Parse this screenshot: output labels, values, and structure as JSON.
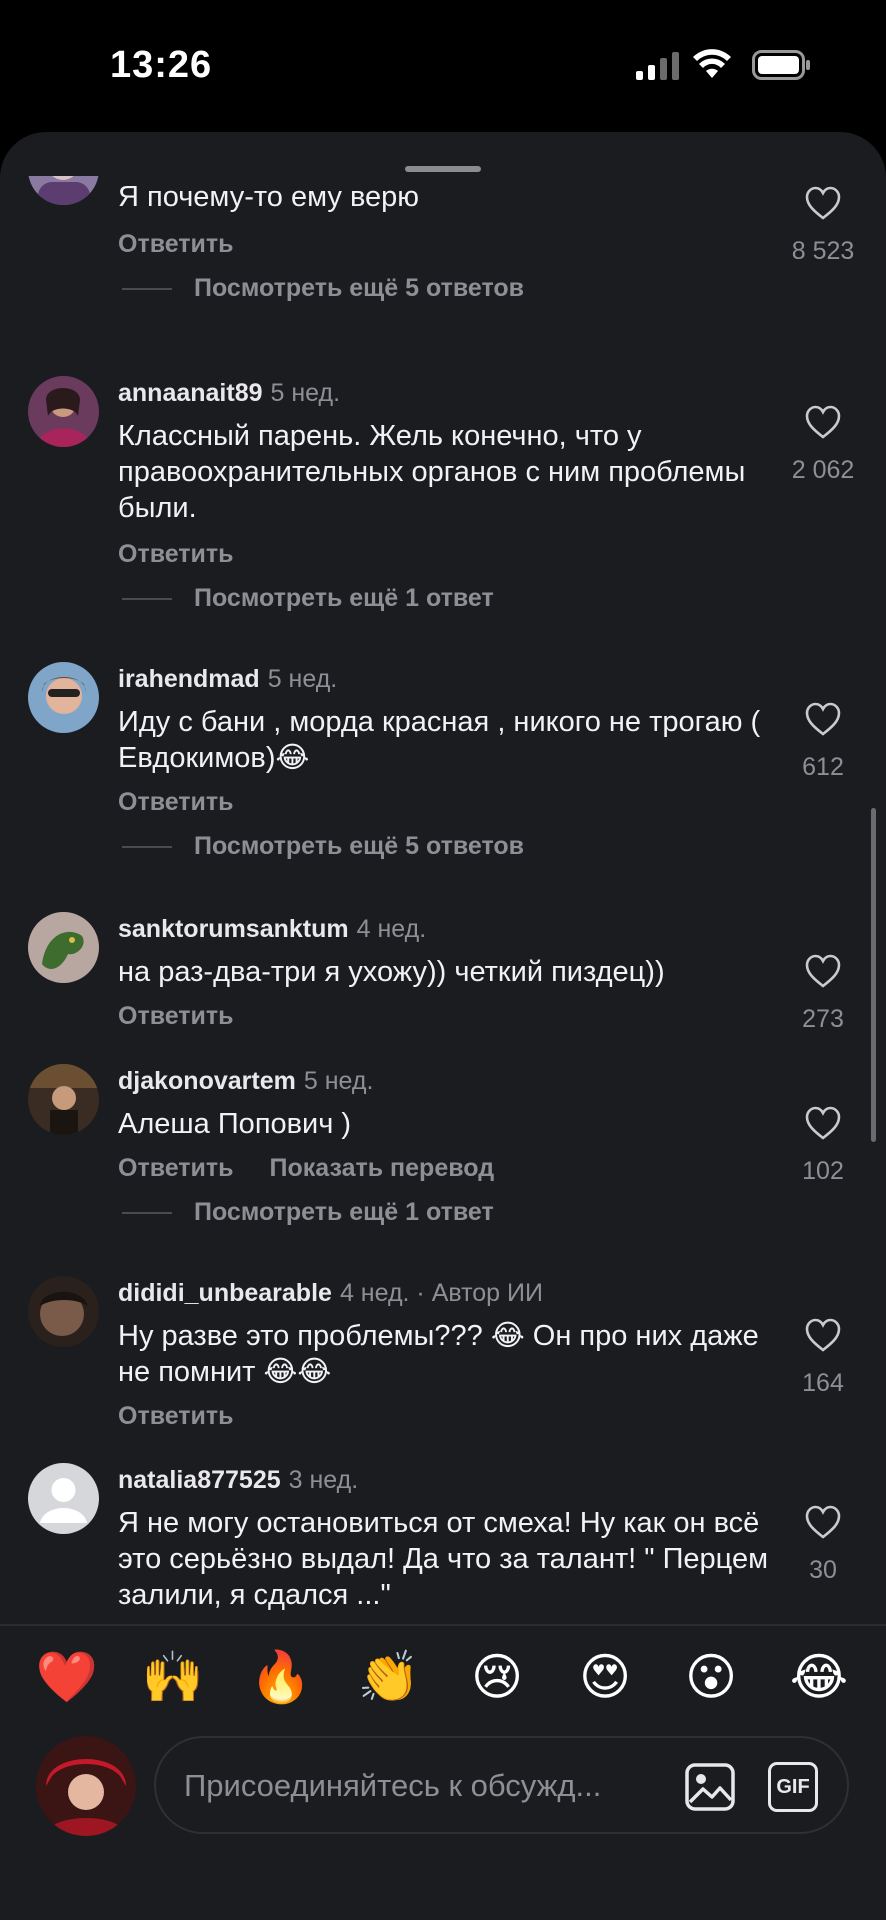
{
  "status_bar": {
    "time": "13:26"
  },
  "comments": [
    {
      "username": "",
      "meta": "",
      "text": "Я почему-то ему верю",
      "actions": [
        "Ответить"
      ],
      "likes": "8 523",
      "replies": "Посмотреть ещё 5 ответов"
    },
    {
      "username": "annaanait89",
      "meta": "5 нед.",
      "text": "Классный парень. Жель конечно, что у правоохранительных органов с ним проблемы были.",
      "actions": [
        "Ответить"
      ],
      "likes": "2 062",
      "replies": "Посмотреть ещё 1 ответ"
    },
    {
      "username": "irahendmad",
      "meta": "5 нед.",
      "text": "Иду с бани , морда красная , никого не трогаю ( Евдокимов)😂",
      "actions": [
        "Ответить"
      ],
      "likes": "612",
      "replies": "Посмотреть ещё 5 ответов"
    },
    {
      "username": "sanktorumsanktum",
      "meta": "4 нед.",
      "text": "на раз-два-три я ухожу)) четкий пиздец))",
      "actions": [
        "Ответить"
      ],
      "likes": "273",
      "replies": ""
    },
    {
      "username": "djakonovartem",
      "meta": "5 нед.",
      "text": "Алеша Попович )",
      "actions": [
        "Ответить",
        "Показать перевод"
      ],
      "likes": "102",
      "replies": "Посмотреть ещё 1 ответ"
    },
    {
      "username": "dididi_unbearable",
      "meta": "4 нед. · Автор ИИ",
      "text": "Ну разве это проблемы??? 😂 Он про них даже не помнит 😂😂",
      "actions": [
        "Ответить"
      ],
      "likes": "164",
      "replies": ""
    },
    {
      "username": "natalia877525",
      "meta": "3 нед.",
      "text": "Я не могу остановиться от смеха! Ну как он всё это серьёзно выдал! Да что за талант! \" Перцем залили, я сдался ...\"",
      "actions": [],
      "likes": "30",
      "replies": ""
    }
  ],
  "emoji_bar": [
    "❤️",
    "🙌",
    "🔥",
    "👏",
    "😢",
    "😍",
    "😮",
    "😂"
  ],
  "input": {
    "placeholder": "Присоединяйтесь к обсужд...",
    "gif_label": "GIF"
  },
  "colors": {
    "background": "#1b1c20",
    "muted": "#8e8f95",
    "text": "#f2f2f4"
  }
}
